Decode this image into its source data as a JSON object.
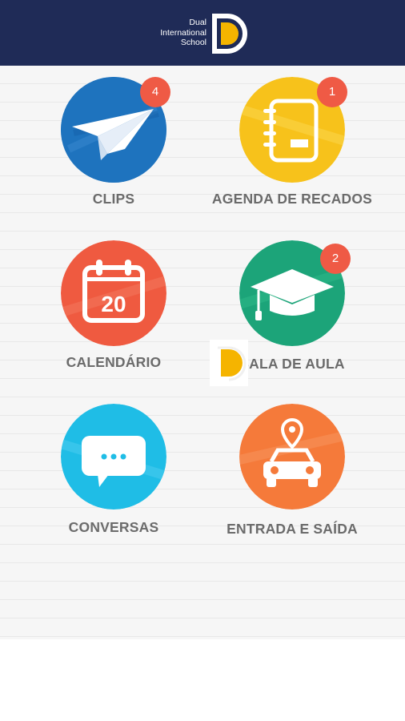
{
  "header": {
    "logo_line1": "Dual",
    "logo_line2": "International",
    "logo_line3": "School",
    "logo_letter": "D",
    "background": "#1f2b57",
    "accent": "#f5b400"
  },
  "tiles": [
    {
      "label": "CLIPS",
      "badge": "4",
      "icon": "paper-plane-icon",
      "color": "#1e73be"
    },
    {
      "label": "AGENDA DE RECADOS",
      "badge": "1",
      "icon": "notebook-icon",
      "color": "#f7c21b"
    },
    {
      "label": "CALENDÁRIO",
      "badge": null,
      "icon": "calendar-icon",
      "calendar_day": "20",
      "color": "#ef5a40"
    },
    {
      "label": "SALA DE AULA",
      "badge": "2",
      "icon": "graduation-cap-icon",
      "color": "#1ca479"
    },
    {
      "label": "CONVERSAS",
      "badge": null,
      "icon": "chat-bubble-icon",
      "color": "#1fbde6"
    },
    {
      "label": "ENTRADA E SAÍDA",
      "badge": null,
      "icon": "car-location-icon",
      "color": "#f57a3a"
    }
  ],
  "badge_color": "#ef5a45"
}
